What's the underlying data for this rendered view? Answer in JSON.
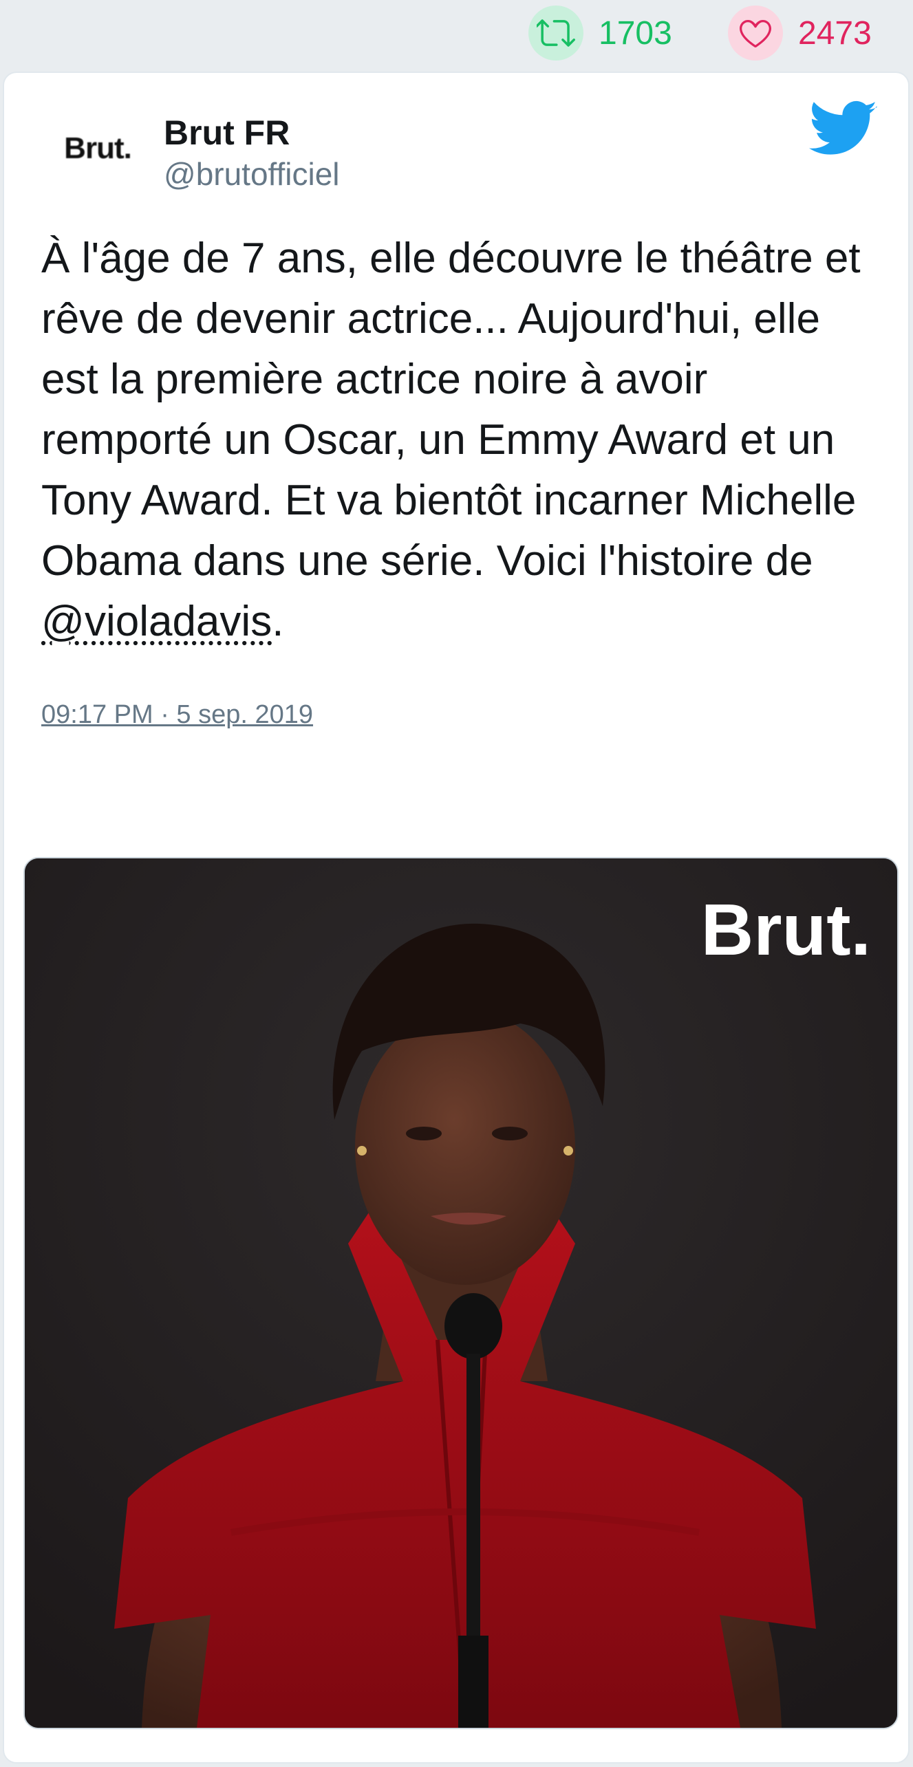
{
  "stats": {
    "retweet_count": "1703",
    "like_count": "2473",
    "retweet_color": "#17bf63",
    "like_color": "#e0245e"
  },
  "tweet": {
    "author_name": "Brut FR",
    "author_handle": "@brutofficiel",
    "avatar_text": "Brut.",
    "text_before_mention": "À l'âge de 7 ans, elle découvre le théâtre et rêve de devenir actrice... Aujourd'hui, elle est la première actrice noire à avoir remporté un Oscar, un Emmy Award et un Tony Award. Et va bientôt incarner Michelle Obama dans une série. Voici l'histoire de ",
    "mention": "@violadavis",
    "text_after_mention": ".",
    "timestamp": "09:17 PM · 5 sep. 2019",
    "media_watermark": "Brut.",
    "twitter_blue": "#1da1f2"
  },
  "icons": {
    "retweet": "retweet-icon",
    "like": "heart-icon",
    "reply": "reply-icon",
    "brand": "twitter-bird-icon"
  }
}
